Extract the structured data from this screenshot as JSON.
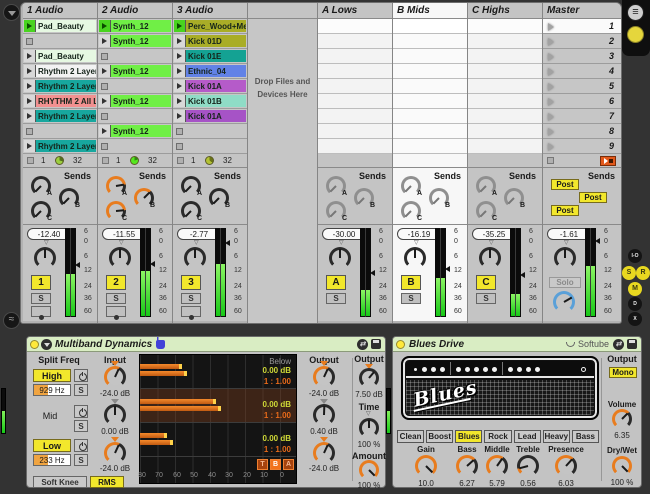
{
  "colors": {
    "orange": "#e87c1e",
    "dark": "#2a2a2a",
    "gray": "#8f8f8f",
    "blue": "#5aa0d8",
    "yellow": "#f2e72c",
    "green_play": "#49d41f"
  },
  "session": {
    "sends_label": "Sends",
    "solo_label": "S",
    "send_letters": [
      "A",
      "B",
      "C"
    ],
    "meter_scale": [
      "6",
      "0",
      "6",
      "12",
      "24",
      "36",
      "60"
    ],
    "scenes": [
      "1",
      "2",
      "3",
      "4",
      "5",
      "6",
      "7",
      "8",
      "9"
    ],
    "view_toggles": [
      "I-O",
      "S",
      "R",
      "M",
      "D",
      "X"
    ],
    "drop_zone": {
      "line1": "Drop Files and",
      "line2": "Devices Here"
    },
    "tracks": [
      {
        "name": "1 Audio",
        "pos": "1",
        "len": "32",
        "volume": "-12.40",
        "number": "1",
        "slots": [
          {
            "label": "Pad_Beauty",
            "bg": "#e6f8e2"
          },
          {
            "label": "Pad_Beauty",
            "bg": "#e6f8e2"
          },
          {
            "label": "Rhythm 2 Layer",
            "bg": "#f2f2f2"
          },
          {
            "label": "Rhythm 2 Layer",
            "bg": "#17a79e"
          },
          {
            "label": "RHYTHM 2 All L",
            "bg": "#f29090"
          },
          {
            "label": "Rhythm 2 Layer",
            "bg": "#17a79e"
          },
          {
            "label": "Rhythm 2 Layer",
            "bg": "#17a79e"
          }
        ]
      },
      {
        "name": "2 Audio",
        "pos": "1",
        "len": "32",
        "volume": "-11.55",
        "number": "2",
        "slots": [
          {
            "label": "Synth_12",
            "bg": "#70ef46"
          },
          {
            "label": "Synth_12",
            "bg": "#70ef46"
          },
          {
            "label": "Synth_12",
            "bg": "#70ef46"
          },
          {
            "label": "Synth_12",
            "bg": "#70ef46"
          },
          {
            "label": "Synth_12",
            "bg": "#70ef46"
          }
        ]
      },
      {
        "name": "3 Audio",
        "pos": "1",
        "len": "32",
        "volume": "-2.77",
        "number": "3",
        "slots": [
          {
            "label": "Perc_Wood+Met",
            "bg": "#a9ad27"
          },
          {
            "label": "Kick 01D",
            "bg": "#a9ad27"
          },
          {
            "label": "Kick 01E",
            "bg": "#14a293"
          },
          {
            "label": "Ethnic_04",
            "bg": "#6282e6"
          },
          {
            "label": "Kick 01A",
            "bg": "#b55bc9"
          },
          {
            "label": "Kick 01B",
            "bg": "#8fdcc6"
          },
          {
            "label": "Kick 01A",
            "bg": "#a653c6"
          }
        ]
      }
    ],
    "returns": [
      {
        "name": "A Lows",
        "volume": "-30.00",
        "letter": "A"
      },
      {
        "name": "B Mids",
        "volume": "-16.19",
        "letter": "B"
      },
      {
        "name": "C Highs",
        "volume": "-35.25",
        "letter": "C"
      }
    ],
    "master": {
      "name": "Master",
      "volume": "-1.61",
      "solo_label": "Solo",
      "posts": [
        "Post",
        "Post",
        "Post"
      ]
    }
  },
  "devices": {
    "multiband": {
      "title": "Multiband Dynamics",
      "split_freq_label": "Split Freq",
      "input_label": "Input",
      "below_label": "Below",
      "output_label": "Output",
      "soft_knee": "Soft Knee",
      "rms": "RMS",
      "bands": {
        "high": {
          "name": "High",
          "freq": "929 Hz",
          "input": "-24.0 dB",
          "below_db": "0.00 dB",
          "below_ratio": "1 : 1.00",
          "output": "-24.0 dB"
        },
        "mid": {
          "name": "Mid",
          "input": "0.00 dB",
          "below_db": "0.00 dB",
          "below_ratio": "1 : 1.00",
          "output": "0.40 dB"
        },
        "low": {
          "name": "Low",
          "freq": "233 Hz",
          "input": "-24.0 dB",
          "below_db": "0.00 dB",
          "below_ratio": "1 : 1.00",
          "output": "-24.0 dB"
        }
      },
      "global": {
        "output_label": "Output",
        "output": "7.50 dB",
        "time_label": "Time",
        "time": "100 %",
        "amount_label": "Amount",
        "amount": "100 %"
      },
      "axis": [
        "80",
        "70",
        "60",
        "50",
        "40",
        "30",
        "20",
        "10",
        "0"
      ],
      "display_buttons": [
        "T",
        "B",
        "A"
      ],
      "meter_bars": {
        "high": [
          "27%",
          "30%"
        ],
        "mid": [
          "49%",
          "52%"
        ],
        "low": [
          "17%",
          "21%"
        ]
      }
    },
    "blues": {
      "title": "Blues Drive",
      "brand": "Softube",
      "logo": "Blues",
      "output_label": "Output",
      "mono": "Mono",
      "modes": [
        "Clean",
        "Boost",
        "Blues",
        "Rock",
        "Lead",
        "Heavy",
        "Bass"
      ],
      "knobs": {
        "gain": {
          "label": "Gain",
          "value": "10.0"
        },
        "bass": {
          "label": "Bass",
          "value": "6.27"
        },
        "middle": {
          "label": "Middle",
          "value": "5.79"
        },
        "treble": {
          "label": "Treble",
          "value": "0.56"
        },
        "presence": {
          "label": "Presence",
          "value": "6.03"
        },
        "volume": {
          "label": "Volume",
          "value": "6.35"
        },
        "drywet": {
          "label": "Dry/Wet",
          "value": "100 %"
        }
      }
    }
  }
}
